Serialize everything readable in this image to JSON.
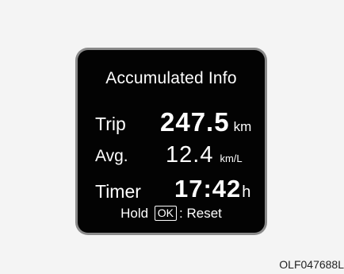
{
  "display": {
    "title": "Accumulated Info",
    "trip": {
      "label": "Trip",
      "value": "247.5",
      "unit": "km"
    },
    "average": {
      "label": "Avg.",
      "value": "12.4",
      "unit": "km/L"
    },
    "timer": {
      "label": "Timer",
      "value": "17:42",
      "unit": "h"
    },
    "hint": {
      "prefix": "Hold",
      "button": "OK",
      "suffix": ": Reset"
    }
  },
  "caption": "OLF047688L",
  "colors": {
    "screen_background": "#030303",
    "bezel": "#8a8a8a",
    "text": "#ffffff",
    "page_background": "#f4f4f4"
  }
}
